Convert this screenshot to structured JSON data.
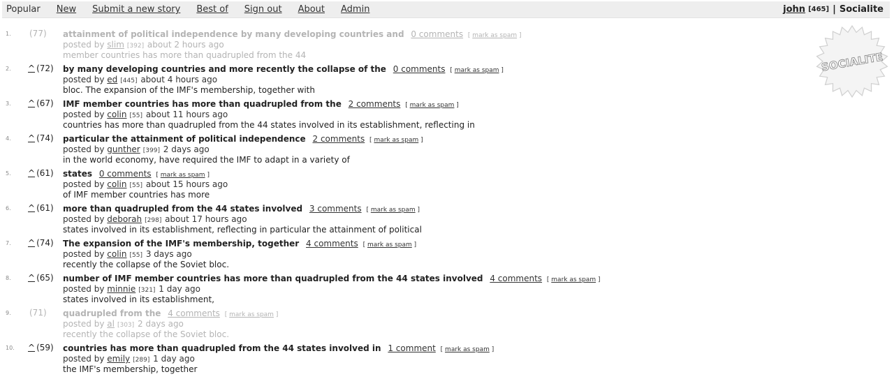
{
  "nav": {
    "items": [
      {
        "label": "Popular",
        "current": true
      },
      {
        "label": "New"
      },
      {
        "label": "Submit a new story"
      },
      {
        "label": "Best of"
      },
      {
        "label": "Sign out"
      },
      {
        "label": "About"
      },
      {
        "label": "Admin"
      }
    ]
  },
  "user": {
    "name": "john",
    "karma": "[465]",
    "separator": "|",
    "site": "Socialite"
  },
  "badge": {
    "text": "SOCIALITE"
  },
  "labels": {
    "posted_by": "posted by",
    "mark_as_spam": "mark as spam",
    "bracket_open": "[",
    "bracket_close": "]",
    "vote_arrow": "^"
  },
  "stories": [
    {
      "rank": "1.",
      "score": "(77)",
      "title": "attainment of political independence by many developing countries and",
      "comments": "0 comments",
      "user": "slim",
      "karma": "[392]",
      "time": "about 2 hours ago",
      "snippet": "member countries has more than quadrupled from the 44",
      "faded": true,
      "votable": false
    },
    {
      "rank": "2.",
      "score": "(72)",
      "title": "by many developing countries and more recently the collapse of the",
      "comments": "0 comments",
      "user": "ed",
      "karma": "[445]",
      "time": "about 4 hours ago",
      "snippet": "bloc. The expansion of the IMF's membership, together with",
      "faded": false,
      "votable": true
    },
    {
      "rank": "3.",
      "score": "(67)",
      "title": "IMF member countries has more than quadrupled from the",
      "comments": "2 comments",
      "user": "colin",
      "karma": "[55]",
      "time": "about 11 hours ago",
      "snippet": "countries has more than quadrupled from the 44 states involved in its establishment, reflecting in",
      "faded": false,
      "votable": true
    },
    {
      "rank": "4.",
      "score": "(74)",
      "title": "particular the attainment of political independence",
      "comments": "2 comments",
      "user": "gunther",
      "karma": "[399]",
      "time": "2 days ago",
      "snippet": "in the world economy, have required the IMF to adapt in a variety of",
      "faded": false,
      "votable": true
    },
    {
      "rank": "5.",
      "score": "(61)",
      "title": "states",
      "comments": "0 comments",
      "user": "colin",
      "karma": "[55]",
      "time": "about 15 hours ago",
      "snippet": "of IMF member countries has more",
      "faded": false,
      "votable": true
    },
    {
      "rank": "6.",
      "score": "(61)",
      "title": "more than quadrupled from the 44 states involved",
      "comments": "3 comments",
      "user": "deborah",
      "karma": "[298]",
      "time": "about 17 hours ago",
      "snippet": "states involved in its establishment, reflecting in particular the attainment of political",
      "faded": false,
      "votable": true
    },
    {
      "rank": "7.",
      "score": "(74)",
      "title": "The expansion of the IMF's membership, together",
      "comments": "4 comments",
      "user": "colin",
      "karma": "[55]",
      "time": "3 days ago",
      "snippet": "recently the collapse of the Soviet bloc.",
      "faded": false,
      "votable": true
    },
    {
      "rank": "8.",
      "score": "(65)",
      "title": "number of IMF member countries has more than quadrupled from the 44 states involved",
      "comments": "4 comments",
      "user": "minnie",
      "karma": "[321]",
      "time": "1 day ago",
      "snippet": "states involved in its establishment,",
      "faded": false,
      "votable": true
    },
    {
      "rank": "9.",
      "score": "(71)",
      "title": "quadrupled from the",
      "comments": "4 comments",
      "user": "al",
      "karma": "[303]",
      "time": "2 days ago",
      "snippet": "recently the collapse of the Soviet bloc.",
      "faded": true,
      "votable": false
    },
    {
      "rank": "10.",
      "score": "(59)",
      "title": "countries has more than quadrupled from the 44 states involved in",
      "comments": "1 comment",
      "user": "emily",
      "karma": "[289]",
      "time": "1 day ago",
      "snippet": "the IMF's membership, together",
      "faded": false,
      "votable": true
    }
  ]
}
